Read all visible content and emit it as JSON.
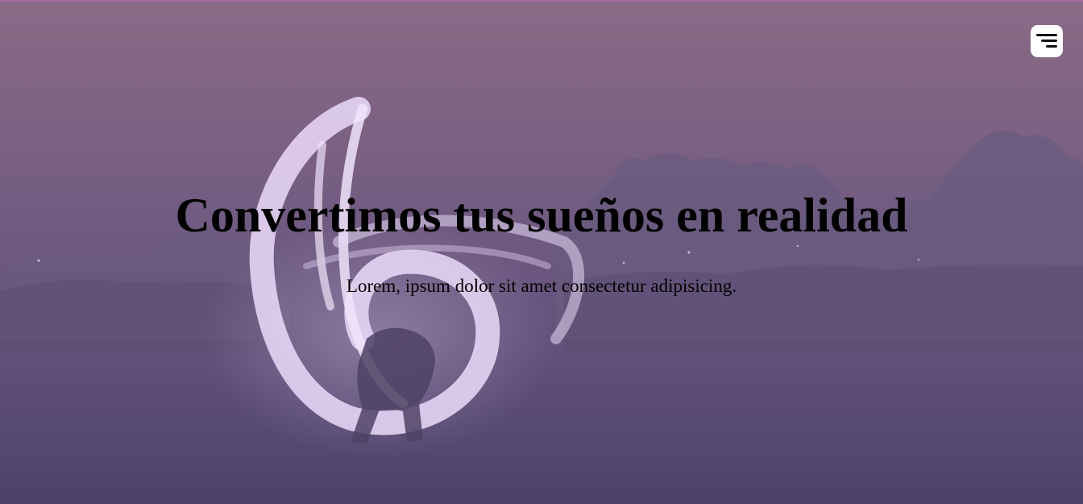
{
  "header": {
    "menu_icon": "menu-icon"
  },
  "hero": {
    "title": "Convertimos tus sueños en realidad",
    "subtitle": "Lorem, ipsum dolor sit amet consectetur adipisicing."
  },
  "colors": {
    "overlay_top": "#8a6a86",
    "overlay_bottom": "#534772",
    "accent_line": "#a46aa0",
    "light_trail": "#e6d4f4",
    "text": "#000000",
    "menu_bg": "#ffffff"
  }
}
